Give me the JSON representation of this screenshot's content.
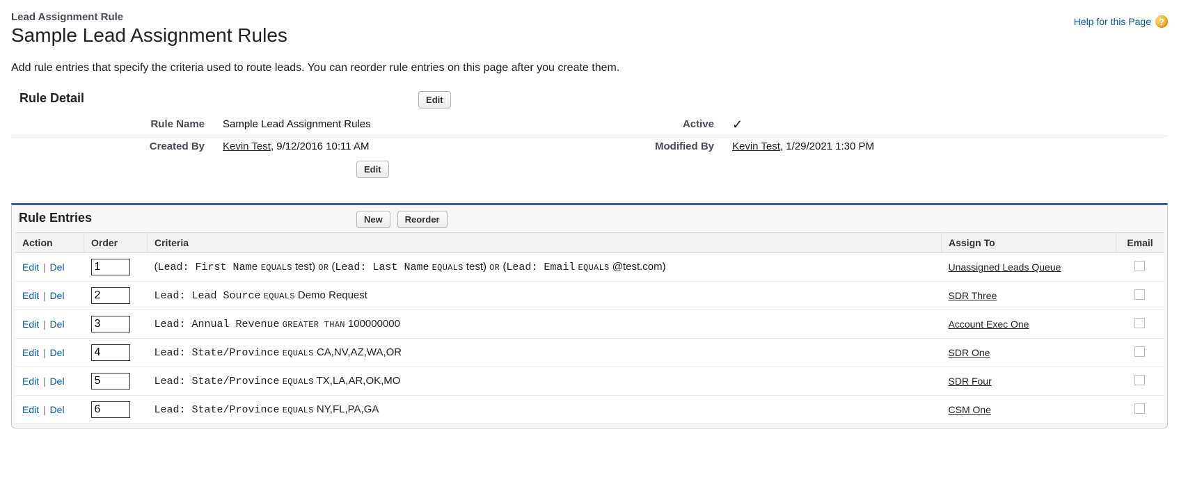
{
  "header": {
    "page_type": "Lead Assignment Rule",
    "title": "Sample Lead Assignment Rules",
    "help_label": "Help for this Page"
  },
  "intro_text": "Add rule entries that specify the criteria used to route leads. You can reorder rule entries on this page after you create them.",
  "detail": {
    "section_title": "Rule Detail",
    "edit_button": "Edit",
    "labels": {
      "rule_name": "Rule Name",
      "active": "Active",
      "created_by": "Created By",
      "modified_by": "Modified By"
    },
    "values": {
      "rule_name": "Sample Lead Assignment Rules",
      "active_check": "✓",
      "created_by_name": "Kevin Test",
      "created_by_ts": ", 9/12/2016 10:11 AM",
      "modified_by_name": "Kevin Test",
      "modified_by_ts": ", 1/29/2021 1:30 PM"
    }
  },
  "entries": {
    "section_title": "Rule Entries",
    "buttons": {
      "new": "New",
      "reorder": "Reorder"
    },
    "action_labels": {
      "edit": "Edit",
      "del": "Del"
    },
    "columns": {
      "action": "Action",
      "order": "Order",
      "criteria": "Criteria",
      "assign_to": "Assign To",
      "email": "Email"
    },
    "rows": [
      {
        "order": "1",
        "criteria_parts": [
          {
            "t": "plain",
            "v": "("
          },
          {
            "t": "mono",
            "v": "Lead: First Name"
          },
          {
            "t": "plain",
            "v": " "
          },
          {
            "t": "op",
            "v": "EQUALS"
          },
          {
            "t": "plain",
            "v": " test) "
          },
          {
            "t": "op",
            "v": "OR"
          },
          {
            "t": "plain",
            "v": " ("
          },
          {
            "t": "mono",
            "v": "Lead: Last Name"
          },
          {
            "t": "plain",
            "v": " "
          },
          {
            "t": "op",
            "v": "EQUALS"
          },
          {
            "t": "plain",
            "v": " test) "
          },
          {
            "t": "op",
            "v": "OR"
          },
          {
            "t": "plain",
            "v": " ("
          },
          {
            "t": "mono",
            "v": "Lead: Email"
          },
          {
            "t": "plain",
            "v": " "
          },
          {
            "t": "op",
            "v": "EQUALS"
          },
          {
            "t": "plain",
            "v": " @test.com)"
          }
        ],
        "assign_to": "Unassigned Leads Queue"
      },
      {
        "order": "2",
        "criteria_parts": [
          {
            "t": "mono",
            "v": "Lead: Lead Source"
          },
          {
            "t": "plain",
            "v": " "
          },
          {
            "t": "op",
            "v": "EQUALS"
          },
          {
            "t": "plain",
            "v": " Demo Request"
          }
        ],
        "assign_to": "SDR Three"
      },
      {
        "order": "3",
        "criteria_parts": [
          {
            "t": "mono",
            "v": "Lead: Annual Revenue"
          },
          {
            "t": "plain",
            "v": " "
          },
          {
            "t": "op",
            "v": "GREATER THAN"
          },
          {
            "t": "plain",
            "v": " 100000000"
          }
        ],
        "assign_to": "Account Exec One"
      },
      {
        "order": "4",
        "criteria_parts": [
          {
            "t": "mono",
            "v": "Lead: State/Province"
          },
          {
            "t": "plain",
            "v": " "
          },
          {
            "t": "op",
            "v": "EQUALS"
          },
          {
            "t": "plain",
            "v": " CA,NV,AZ,WA,OR"
          }
        ],
        "assign_to": "SDR One"
      },
      {
        "order": "5",
        "criteria_parts": [
          {
            "t": "mono",
            "v": "Lead: State/Province"
          },
          {
            "t": "plain",
            "v": " "
          },
          {
            "t": "op",
            "v": "EQUALS"
          },
          {
            "t": "plain",
            "v": " TX,LA,AR,OK,MO"
          }
        ],
        "assign_to": "SDR Four"
      },
      {
        "order": "6",
        "criteria_parts": [
          {
            "t": "mono",
            "v": "Lead: State/Province"
          },
          {
            "t": "plain",
            "v": " "
          },
          {
            "t": "op",
            "v": "EQUALS"
          },
          {
            "t": "plain",
            "v": " NY,FL,PA,GA"
          }
        ],
        "assign_to": "CSM One"
      }
    ]
  }
}
